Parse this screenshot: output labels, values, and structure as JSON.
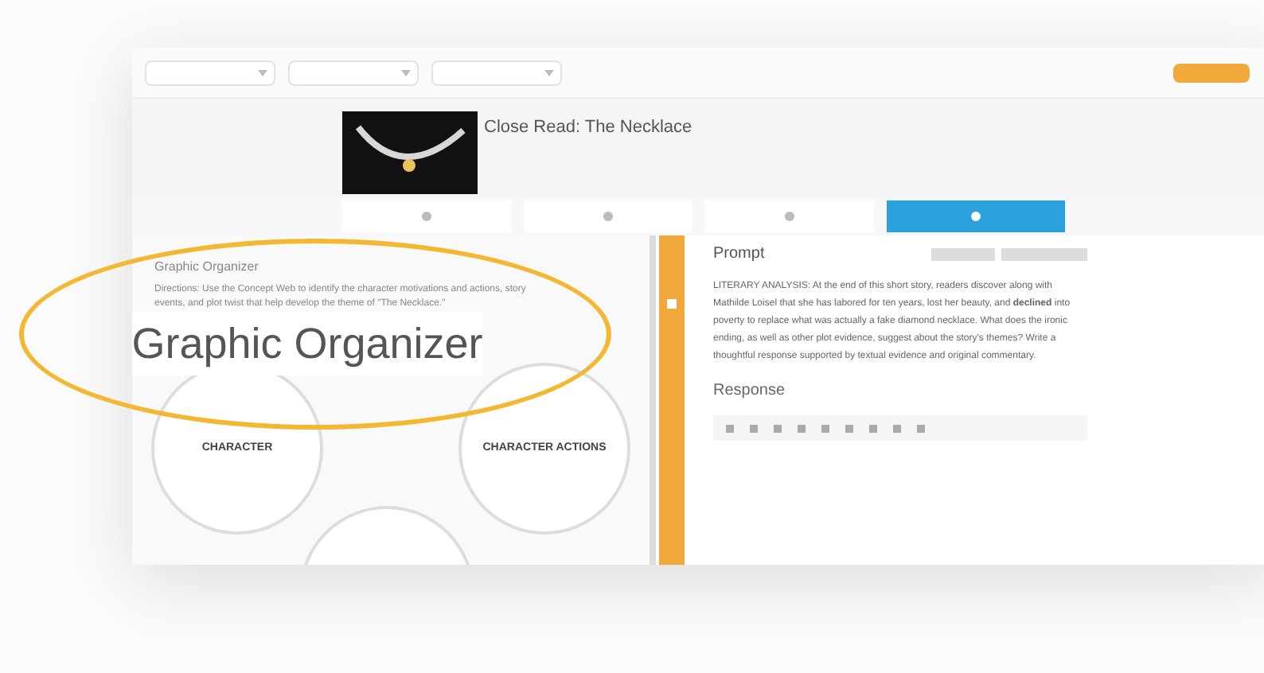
{
  "filters": [
    {
      "kind": "dropdown"
    },
    {
      "kind": "dropdown"
    },
    {
      "kind": "dropdown"
    }
  ],
  "lesson": {
    "title": "Close Read: The Necklace"
  },
  "tabs": [
    {
      "selected": false
    },
    {
      "selected": false
    },
    {
      "selected": false
    },
    {
      "selected": true
    }
  ],
  "organizer": {
    "title": "Graphic Organizer",
    "directions": "Directions: Use the Concept Web to identify the character motivations and actions, story events, and plot twist that help develop the theme of \"The Necklace.\"",
    "nodes": [
      {
        "label": "CHARACTER"
      },
      {
        "label": "CHARACTER ACTIONS"
      }
    ]
  },
  "prompt": {
    "heading": "Prompt",
    "text": "LITERARY ANALYSIS: At the end of this short story, readers discover along with Mathilde Loisel that she has labored for ten years, lost her beauty, and **declined** into poverty to replace what was actually a fake diamond necklace. What does the ironic ending, as well as other plot evidence, suggest about the story's themes? Write a thoughtful response supported by textual evidence and original commentary."
  },
  "response": {
    "heading": "Response",
    "toolbar_buttons": [
      {
        "kind": "format"
      },
      {
        "kind": "format"
      },
      {
        "kind": "format"
      },
      {
        "kind": "format"
      },
      {
        "kind": "format"
      },
      {
        "kind": "format"
      },
      {
        "kind": "format"
      },
      {
        "kind": "format"
      },
      {
        "kind": "format"
      }
    ]
  },
  "callout": {
    "text": "Graphic Organizer"
  }
}
